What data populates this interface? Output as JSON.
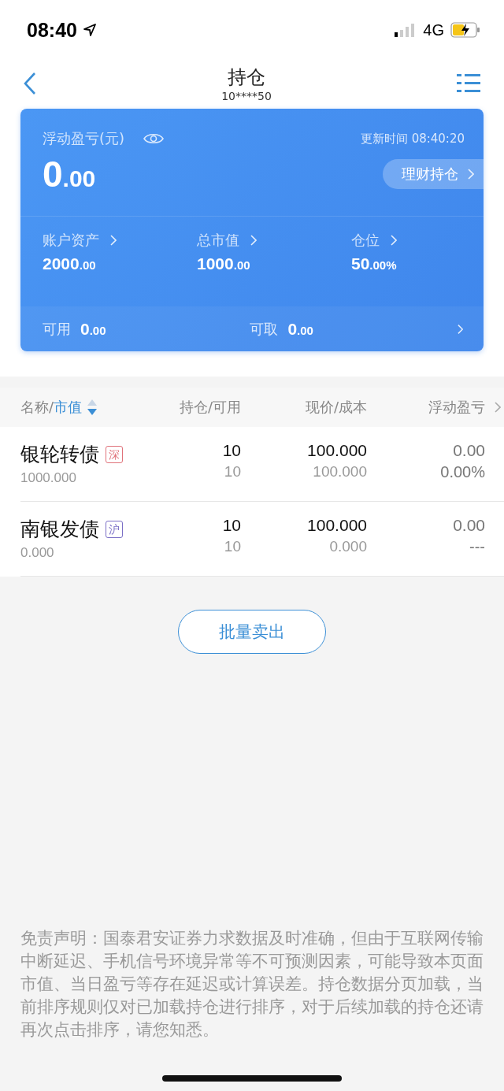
{
  "status_bar": {
    "time": "08:40",
    "network": "4G"
  },
  "header": {
    "title": "持仓",
    "account": "10****50"
  },
  "summary": {
    "pnl_label": "浮动盈亏(元)",
    "updated": "更新时间 08:40:20",
    "pnl": {
      "int": "0",
      "dec": ".00"
    },
    "wealth_button": "理财持仓",
    "stats": [
      {
        "label": "账户资产",
        "int": "2000",
        "dec": ".00"
      },
      {
        "label": "总市值",
        "int": "1000",
        "dec": ".00"
      },
      {
        "label": "仓位",
        "int": "50",
        "dec": ".00%"
      }
    ],
    "footer": [
      {
        "label": "可用",
        "int": "0",
        "dec": ".00"
      },
      {
        "label": "可取",
        "int": "0",
        "dec": ".00"
      }
    ]
  },
  "table": {
    "columns": [
      {
        "label": "名称/",
        "sort_label": "市值",
        "descending": true
      },
      {
        "label": "持仓/可用"
      },
      {
        "label": "现价/成本"
      },
      {
        "label": "浮动盈亏"
      }
    ],
    "rows": [
      {
        "name": "银轮转债",
        "market": "深",
        "color": "#e0727a",
        "value": "1000.000",
        "qty": "10",
        "avail": "10",
        "price": "100.000",
        "cost": "100.000",
        "pnl": "0.00",
        "pnl_pct": "0.00%"
      },
      {
        "name": "南银发债",
        "market": "沪",
        "color": "#7b6fc6",
        "value": "0.000",
        "qty": "10",
        "avail": "10",
        "price": "100.000",
        "cost": "0.000",
        "pnl": "0.00",
        "pnl_pct": "---"
      }
    ]
  },
  "batch_sell_button": "批量卖出",
  "disclaimer": "免责声明：国泰君安证券力求数据及时准确，但由于互联网传输中断延迟、手机信号环境异常等不可预测因素，可能导致本页面市值、当日盈亏等存在延迟或计算误差。持仓数据分页加载，当前排序规则仅对已加载持仓进行排序，对于后续加载的持仓还请再次点击排序，请您知悉。"
}
